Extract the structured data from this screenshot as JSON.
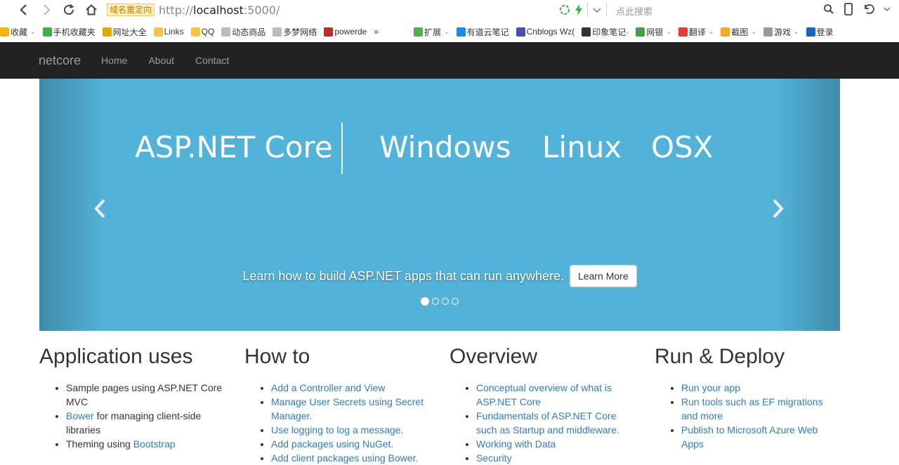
{
  "browser": {
    "redirect_badge": "域名重定向",
    "url_prefix": "http://",
    "url_host": "localhost",
    "url_suffix": ":5000/",
    "search_placeholder": "点此搜索"
  },
  "bookmarks": [
    {
      "label": "收藏",
      "icon": "star-icon",
      "color": "#f4b400"
    },
    {
      "label": "手机收藏夹",
      "icon": "phone-icon",
      "color": "#3cb043"
    },
    {
      "label": "网址大全",
      "icon": "globe-icon",
      "color": "#e0a800"
    },
    {
      "label": "Links",
      "icon": "folder-icon",
      "color": "#f5c542"
    },
    {
      "label": "QQ",
      "icon": "folder-icon",
      "color": "#f5c542"
    },
    {
      "label": "动态商品",
      "icon": "page-icon",
      "color": "#bbbbbb"
    },
    {
      "label": "多梦网络",
      "icon": "page-icon",
      "color": "#bbbbbb"
    },
    {
      "label": "powerde",
      "icon": "app-icon",
      "color": "#c62828"
    },
    {
      "label": "»",
      "icon": "",
      "color": ""
    },
    {
      "label": "扩展",
      "icon": "grid-icon",
      "color": "#4caf50"
    },
    {
      "label": "有道云笔记",
      "icon": "note-icon",
      "color": "#1e88e5"
    },
    {
      "label": "Cnblogs Wz(",
      "icon": "wz-icon",
      "color": "#3f51b5"
    },
    {
      "label": "印象笔记·",
      "icon": "evernote-icon",
      "color": "#333333"
    },
    {
      "label": "网银",
      "icon": "bank-icon",
      "color": "#43a047"
    },
    {
      "label": "翻译",
      "icon": "translate-icon",
      "color": "#e53935"
    },
    {
      "label": "截图",
      "icon": "screenshot-icon",
      "color": "#f9a825"
    },
    {
      "label": "游戏",
      "icon": "game-icon",
      "color": "#999999"
    },
    {
      "label": "登录",
      "icon": "search-icon",
      "color": "#1565c0"
    }
  ],
  "site": {
    "brand": "netcore",
    "nav": [
      "Home",
      "About",
      "Contact"
    ]
  },
  "carousel": {
    "words": [
      "ASP.NET Core",
      "Windows",
      "Linux",
      "OSX"
    ],
    "caption": "Learn how to build ASP.NET apps that can run anywhere.",
    "button": "Learn More",
    "slides": 4,
    "active_slide": 1,
    "prev": "‹",
    "next": "›"
  },
  "columns": [
    {
      "title": "Application uses",
      "items": [
        {
          "parts": [
            {
              "t": "Sample pages using ASP.NET Core MVC",
              "link": false
            }
          ]
        },
        {
          "parts": [
            {
              "t": "Bower",
              "link": true
            },
            {
              "t": " for managing client-side libraries",
              "link": false
            }
          ]
        },
        {
          "parts": [
            {
              "t": "Theming using ",
              "link": false
            },
            {
              "t": "Bootstrap",
              "link": true
            }
          ]
        }
      ]
    },
    {
      "title": "How to",
      "items": [
        {
          "parts": [
            {
              "t": "Add a Controller and View",
              "link": true
            }
          ]
        },
        {
          "parts": [
            {
              "t": "Manage User Secrets using Secret Manager.",
              "link": true
            }
          ]
        },
        {
          "parts": [
            {
              "t": "Use logging to log a message.",
              "link": true
            }
          ]
        },
        {
          "parts": [
            {
              "t": "Add packages using NuGet.",
              "link": true
            }
          ]
        },
        {
          "parts": [
            {
              "t": "Add client packages using Bower.",
              "link": true
            }
          ]
        }
      ]
    },
    {
      "title": "Overview",
      "items": [
        {
          "parts": [
            {
              "t": "Conceptual overview of what is ASP.NET Core",
              "link": true
            }
          ]
        },
        {
          "parts": [
            {
              "t": "Fundamentals of ASP.NET Core such as Startup and middleware.",
              "link": true
            }
          ]
        },
        {
          "parts": [
            {
              "t": "Working with Data",
              "link": true
            }
          ]
        },
        {
          "parts": [
            {
              "t": "Security",
              "link": true
            }
          ]
        }
      ]
    },
    {
      "title": "Run & Deploy",
      "items": [
        {
          "parts": [
            {
              "t": "Run your app",
              "link": true
            }
          ]
        },
        {
          "parts": [
            {
              "t": "Run tools such as EF migrations and more",
              "link": true
            }
          ]
        },
        {
          "parts": [
            {
              "t": "Publish to Microsoft Azure Web Apps",
              "link": true
            }
          ]
        }
      ]
    }
  ]
}
